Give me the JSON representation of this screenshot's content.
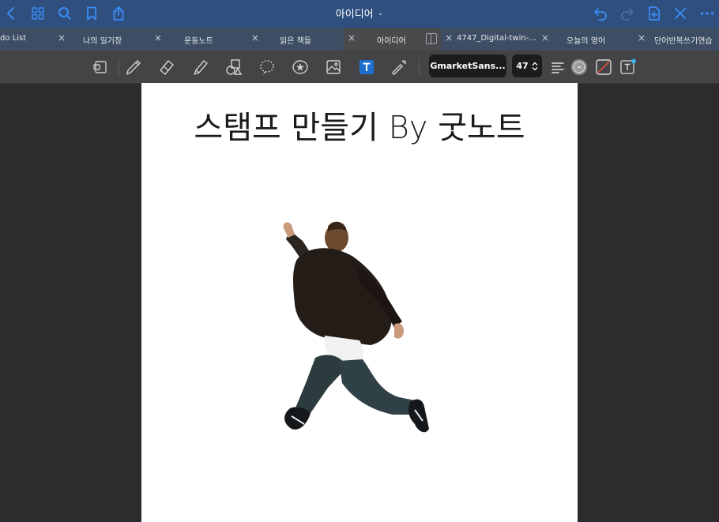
{
  "header": {
    "title": "아이디어",
    "title_chevron": "⌄"
  },
  "tabs": [
    {
      "label": "do List",
      "close": "×"
    },
    {
      "label": "나의 일기장",
      "close": "×"
    },
    {
      "label": "운동노트",
      "close": "×"
    },
    {
      "label": "읽은 책들",
      "close": "×"
    },
    {
      "label": "아이디어",
      "close": "×",
      "active": true
    },
    {
      "label": "4747_Digital-twin-...",
      "close": "×"
    },
    {
      "label": "오늘의 영어",
      "close": "×"
    },
    {
      "label": "단어반복쓰기연습",
      "close": ""
    }
  ],
  "toolbar": {
    "font_name": "GmarketSans...",
    "font_size": "47",
    "font_size_stepper": "⌃⌄"
  },
  "page": {
    "title": "스탬프 만들기 By 굿노트"
  },
  "colors": {
    "topbar": "#2f4f7e",
    "accent": "#3b8cf5",
    "tabbar": "#3d4d63",
    "toolbar": "#444446",
    "canvas": "#2c2c2e",
    "text_tool_active": "#1f6fd0"
  }
}
